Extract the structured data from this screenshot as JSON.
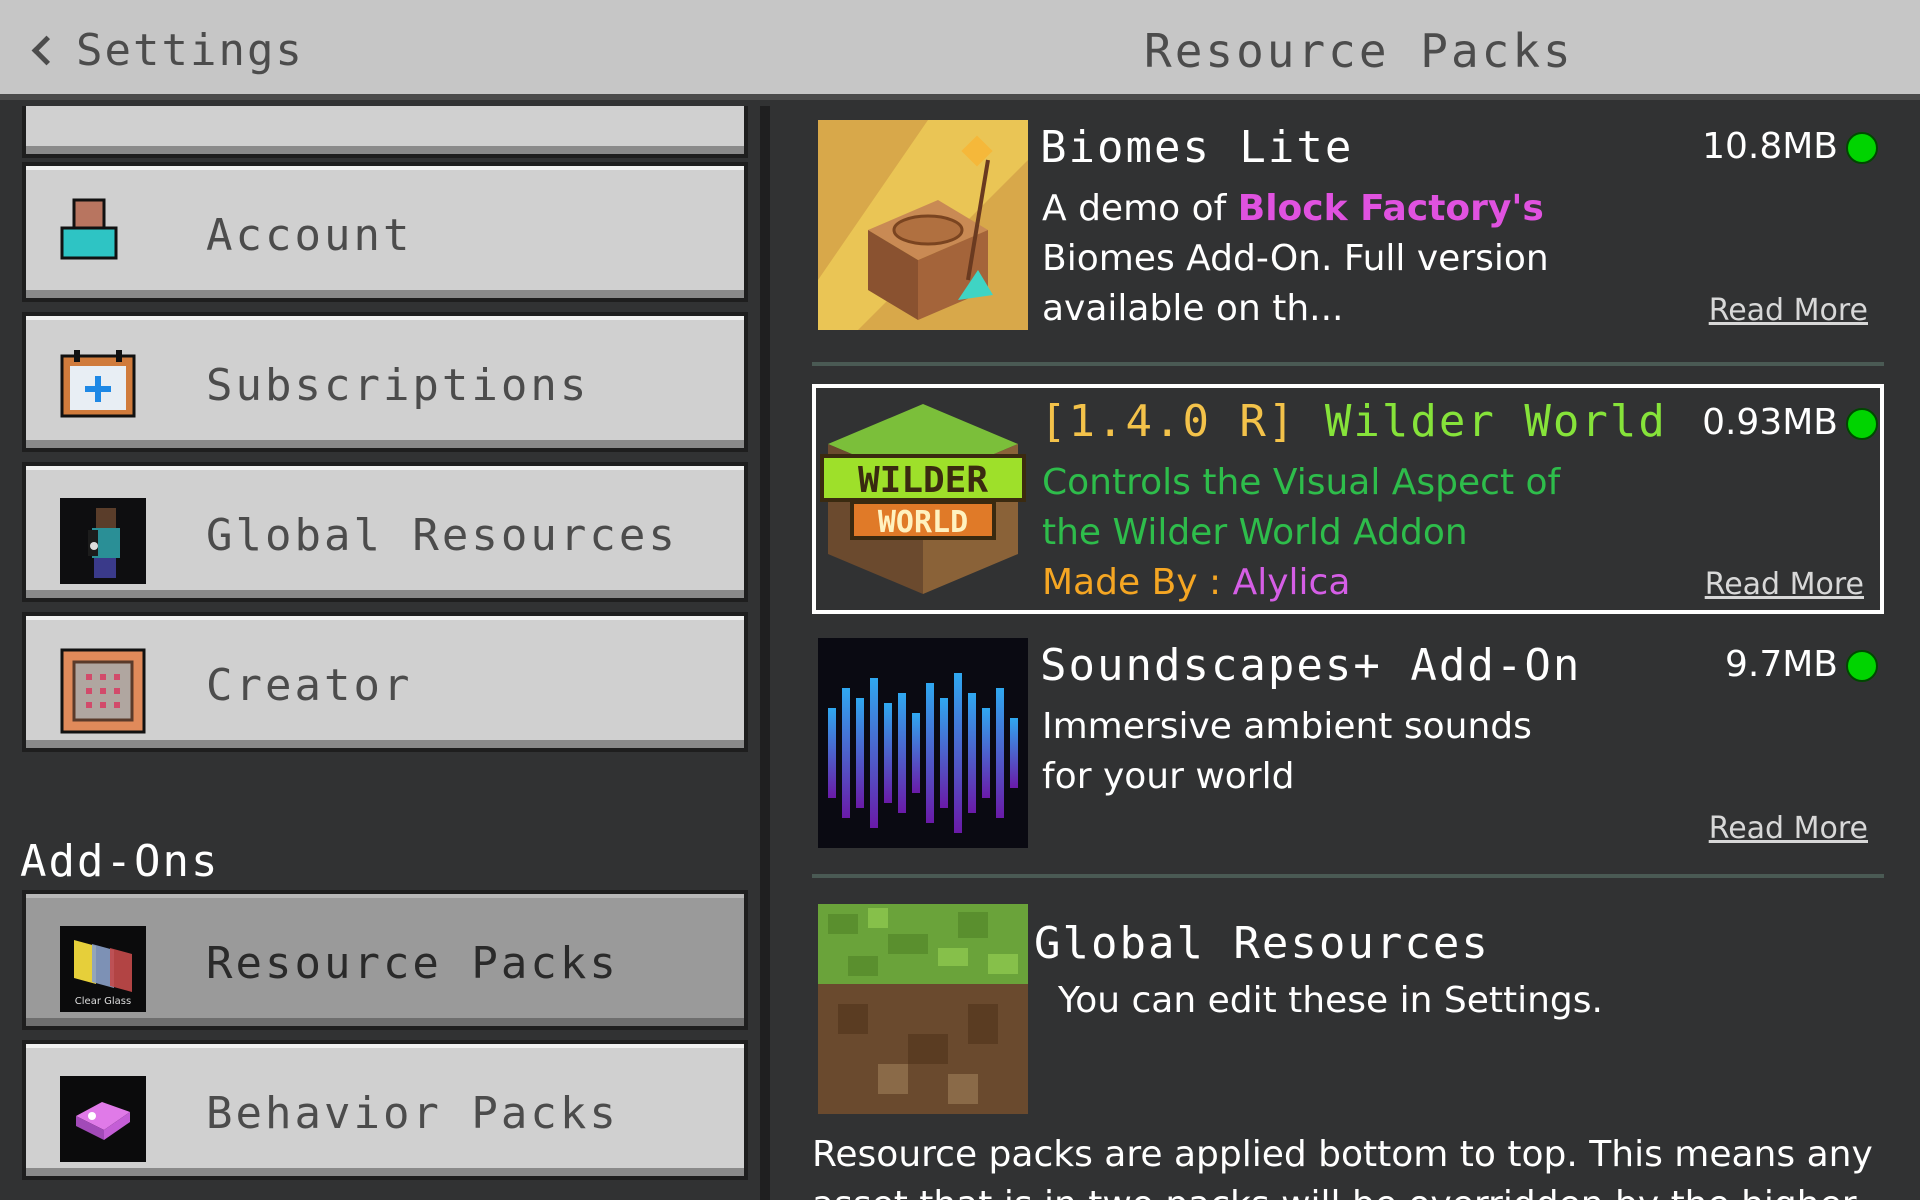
{
  "header": {
    "back_label": "Settings",
    "title": "Resource Packs"
  },
  "sidebar": {
    "items": [
      {
        "label": "Account",
        "icon": "account-icon"
      },
      {
        "label": "Subscriptions",
        "icon": "subscriptions-icon"
      },
      {
        "label": "Global Resources",
        "icon": "global-resources-icon"
      },
      {
        "label": "Creator",
        "icon": "creator-icon"
      }
    ],
    "addons_title": "Add-Ons",
    "addons": [
      {
        "label": "Resource Packs",
        "icon": "resource-packs-icon",
        "selected": true,
        "icon_text": "Clear Glass"
      },
      {
        "label": "Behavior Packs",
        "icon": "behavior-packs-icon",
        "selected": false
      }
    ]
  },
  "packs": [
    {
      "name": "Biomes Lite",
      "desc_part1": "A demo of ",
      "desc_highlight": "Block Factory's",
      "desc_part2": " Biomes Add-On. Full version available on th...",
      "size": "10.8MB",
      "read_more": "Read More"
    },
    {
      "name_version": "[1.4.0 R]",
      "name_title": "Wilder World",
      "desc": "Controls the Visual Aspect of the Wilder World Addon",
      "made_by_label": "Made By : ",
      "made_by_name": "Alylica",
      "size": "0.93MB",
      "read_more": "Read More",
      "logo_line1": "WILDER",
      "logo_line2": "WORLD"
    },
    {
      "name": "Soundscapes+ Add-On",
      "desc": "Immersive ambient sounds for your world",
      "size": "9.7MB",
      "read_more": "Read More"
    }
  ],
  "global_resources": {
    "name": "Global Resources",
    "desc": "You can edit these in Settings."
  },
  "footer": "Resource packs are applied bottom to top. This means any asset that is in two packs will be overridden by the higher",
  "colors": {
    "active_dot": "#00d400",
    "highlight_magenta": "#e052e0",
    "desc_green": "#2ebd4b",
    "made_by_orange": "#f5a623",
    "author_violet": "#d55ee6"
  }
}
